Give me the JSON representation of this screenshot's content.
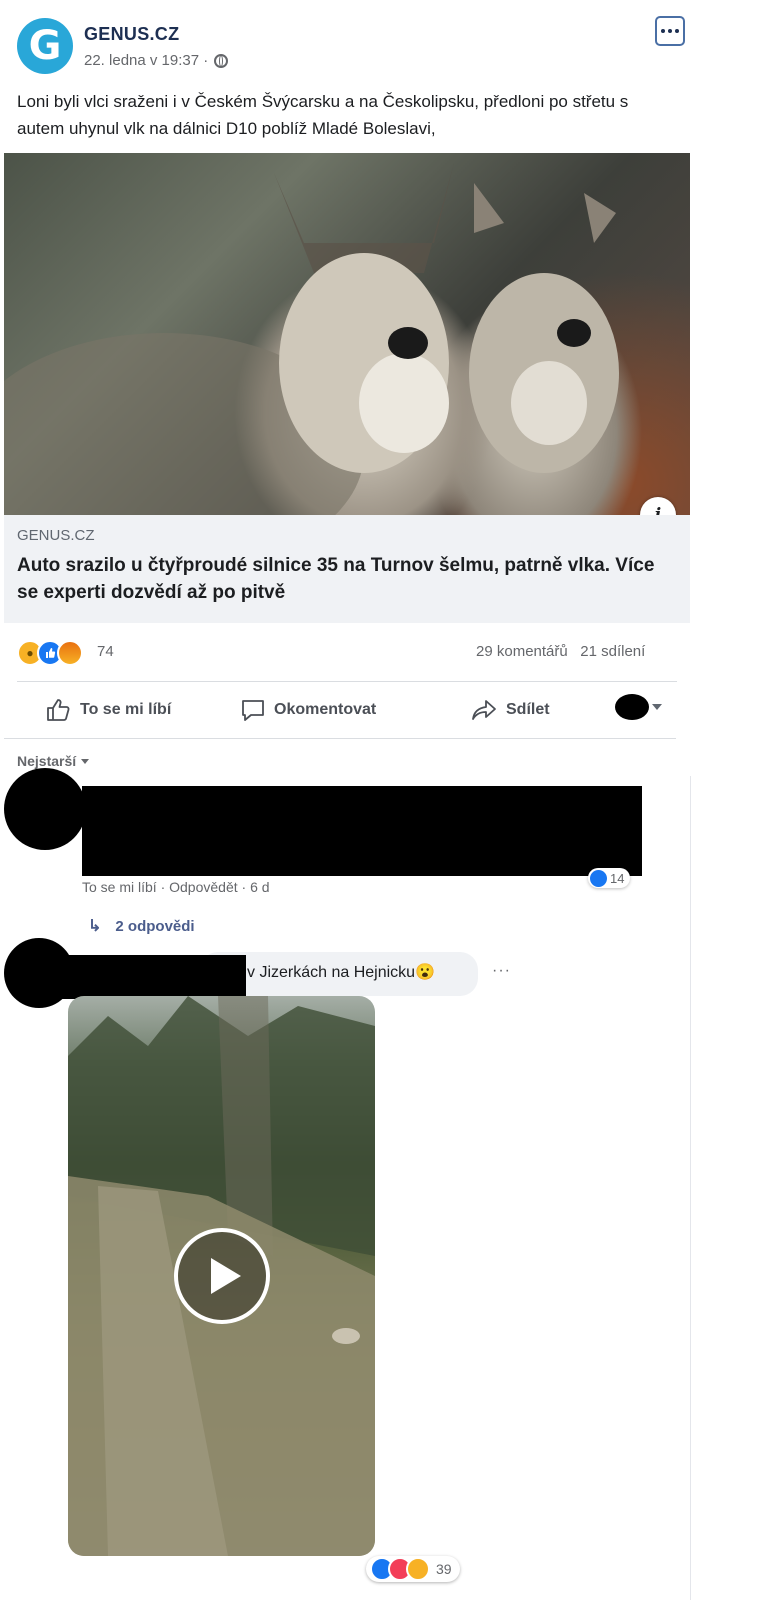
{
  "post": {
    "page_name": "GENUS.CZ",
    "logo_letter": "G",
    "timestamp": "22. ledna v 19:37 ·",
    "text": "Loni byli vlci sraženi i v Českém Švýcarsku a na Českolipsku, předloni po střetu s autem uhynul vlk na dálnici D10 poblíž Mladé Boleslavi,",
    "link": {
      "domain": "GENUS.CZ",
      "title": "Auto srazilo u čtyřproudé silnice 35 na Turnov šelmu, patrně vlka. Více se experti dozvědí až po pitvě",
      "info_label": "i"
    },
    "reaction_count": "74",
    "comments_count": "29 komentářů",
    "shares_count": "21 sdílení",
    "actions": {
      "like": "To se mi líbí",
      "comment": "Okomentovat",
      "share": "Sdílet"
    }
  },
  "comments_section": {
    "sort_label": "Nejstarší",
    "comment1": {
      "actions": "To se mi líbí · Odpovědět · 6 d",
      "reaction_count": "14",
      "replies": "2 odpovědi"
    },
    "comment2": {
      "text": "v Jizerkách na Hejnicku😮",
      "more": "···",
      "video_reaction_count": "39"
    }
  },
  "colors": {
    "brand": "#29a7d8",
    "link_bg": "#f0f2f5",
    "like_blue": "#1877f2"
  }
}
